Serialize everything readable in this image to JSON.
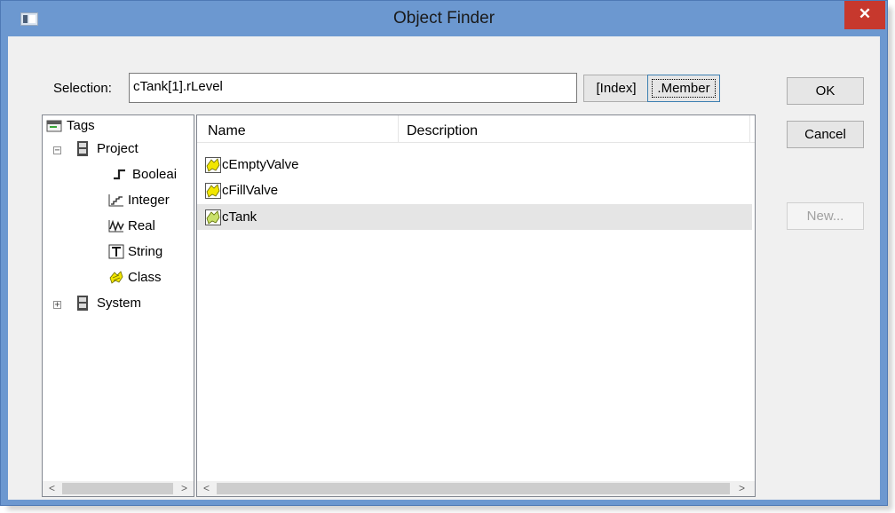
{
  "window": {
    "title": "Object Finder",
    "close_glyph": "✕"
  },
  "selection": {
    "label": "Selection:",
    "value": "cTank[1].rLevel"
  },
  "buttons": {
    "index": "[Index]",
    "member": ".Member",
    "ok": "OK",
    "cancel": "Cancel",
    "new": "New..."
  },
  "tree": {
    "root": {
      "label": "Tags",
      "icon": "tags-icon"
    },
    "project": {
      "label": "Project",
      "expander": "−",
      "icon": "folder-icon"
    },
    "children": [
      {
        "label": "Booleai",
        "icon": "boolean-icon"
      },
      {
        "label": "Integer",
        "icon": "integer-icon"
      },
      {
        "label": "Real",
        "icon": "real-icon"
      },
      {
        "label": "String",
        "icon": "string-icon"
      },
      {
        "label": "Class",
        "icon": "class-icon"
      }
    ],
    "system": {
      "label": "System",
      "expander": "+",
      "icon": "folder-icon"
    }
  },
  "list": {
    "columns": [
      "Name",
      "Description"
    ],
    "rows": [
      {
        "name": "cEmptyValve",
        "description": "",
        "icon": "class-icon"
      },
      {
        "name": "cFillValve",
        "description": "",
        "icon": "class-icon"
      },
      {
        "name": "cTank",
        "description": "",
        "icon": "class-icon",
        "selected": true
      }
    ]
  },
  "scroll": {
    "left_arrow": "<",
    "right_arrow": ">"
  },
  "colors": {
    "title_bar": "#6c98d0",
    "close_button": "#c7382d",
    "selection_row": "#e5e5e5",
    "class_icon": "#f2e600"
  }
}
